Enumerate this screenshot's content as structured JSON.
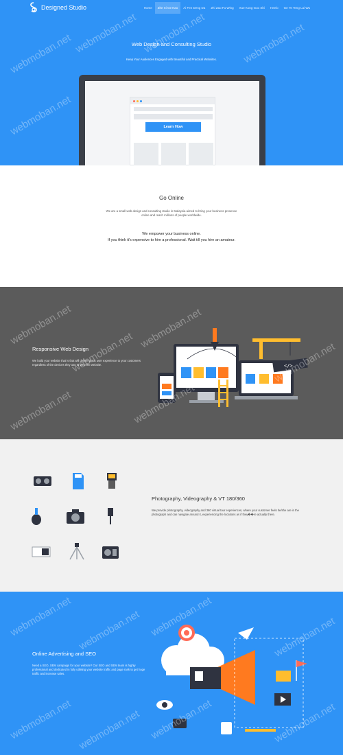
{
  "brand": {
    "name": "Designed Studio"
  },
  "nav": {
    "items": [
      {
        "label": "Home",
        "active": false
      },
      {
        "label": "Zhe Xi Ge Kao",
        "active": true
      },
      {
        "label": "Ai Fen Deng Da",
        "active": false
      },
      {
        "label": "Zhi Zao Fu Wing",
        "active": false
      },
      {
        "label": "Xue Kong Guo Shi",
        "active": false
      },
      {
        "label": "Heelo",
        "active": false
      },
      {
        "label": "Ge Ye Teng Lai Wu",
        "active": false
      }
    ]
  },
  "hero": {
    "title": "Web Design and Consulting Studio",
    "subtitle": "Keep Your Audiences Engaged with Beautiful and Practical Websites.",
    "button": "Learn How"
  },
  "go_online": {
    "title": "Go Online",
    "text": "We are a small web design and consulting studio in Malaysia aimed to bring your business presence online and reach millions of people worldwide.",
    "quote_line1": "We empower your business online.",
    "quote_line2": "If you think it's expensive to hire a professional. Wait till you hire an amateur."
  },
  "responsive": {
    "title": "Responsive Web Design",
    "text": "We build your website that is that will deliver great user experience to your customers regardless of the devices they use to view the website."
  },
  "photography": {
    "title": "Photography, Videography & VT 180/360",
    "text": "We provide photography, videography and 360 virtual tour experiences, where your customer feels he/she are in the photograph and can navigate around it, experiencing the locations as if they��re actually there.",
    "icons": [
      "film-reel-icon",
      "sd-card-icon",
      "flash-icon",
      "blower-icon",
      "camera-icon",
      "cable-icon",
      "battery-grip-icon",
      "tripod-icon",
      "radio-icon"
    ]
  },
  "advertising": {
    "title": "Online Advertising and SEO",
    "text": "Need a SEO, SEM campaign for your website? Our SEO and SEM team is highly professional and dedicated in fully utilising your website traffic and page rank to get huge traffic and increase sales."
  },
  "watermark": {
    "text": "webmoban.net"
  },
  "colors": {
    "primary": "#2f93f6",
    "dark_section": "#5b5b5b",
    "light_section": "#f1f1f1",
    "orange": "#ff7a1f"
  }
}
